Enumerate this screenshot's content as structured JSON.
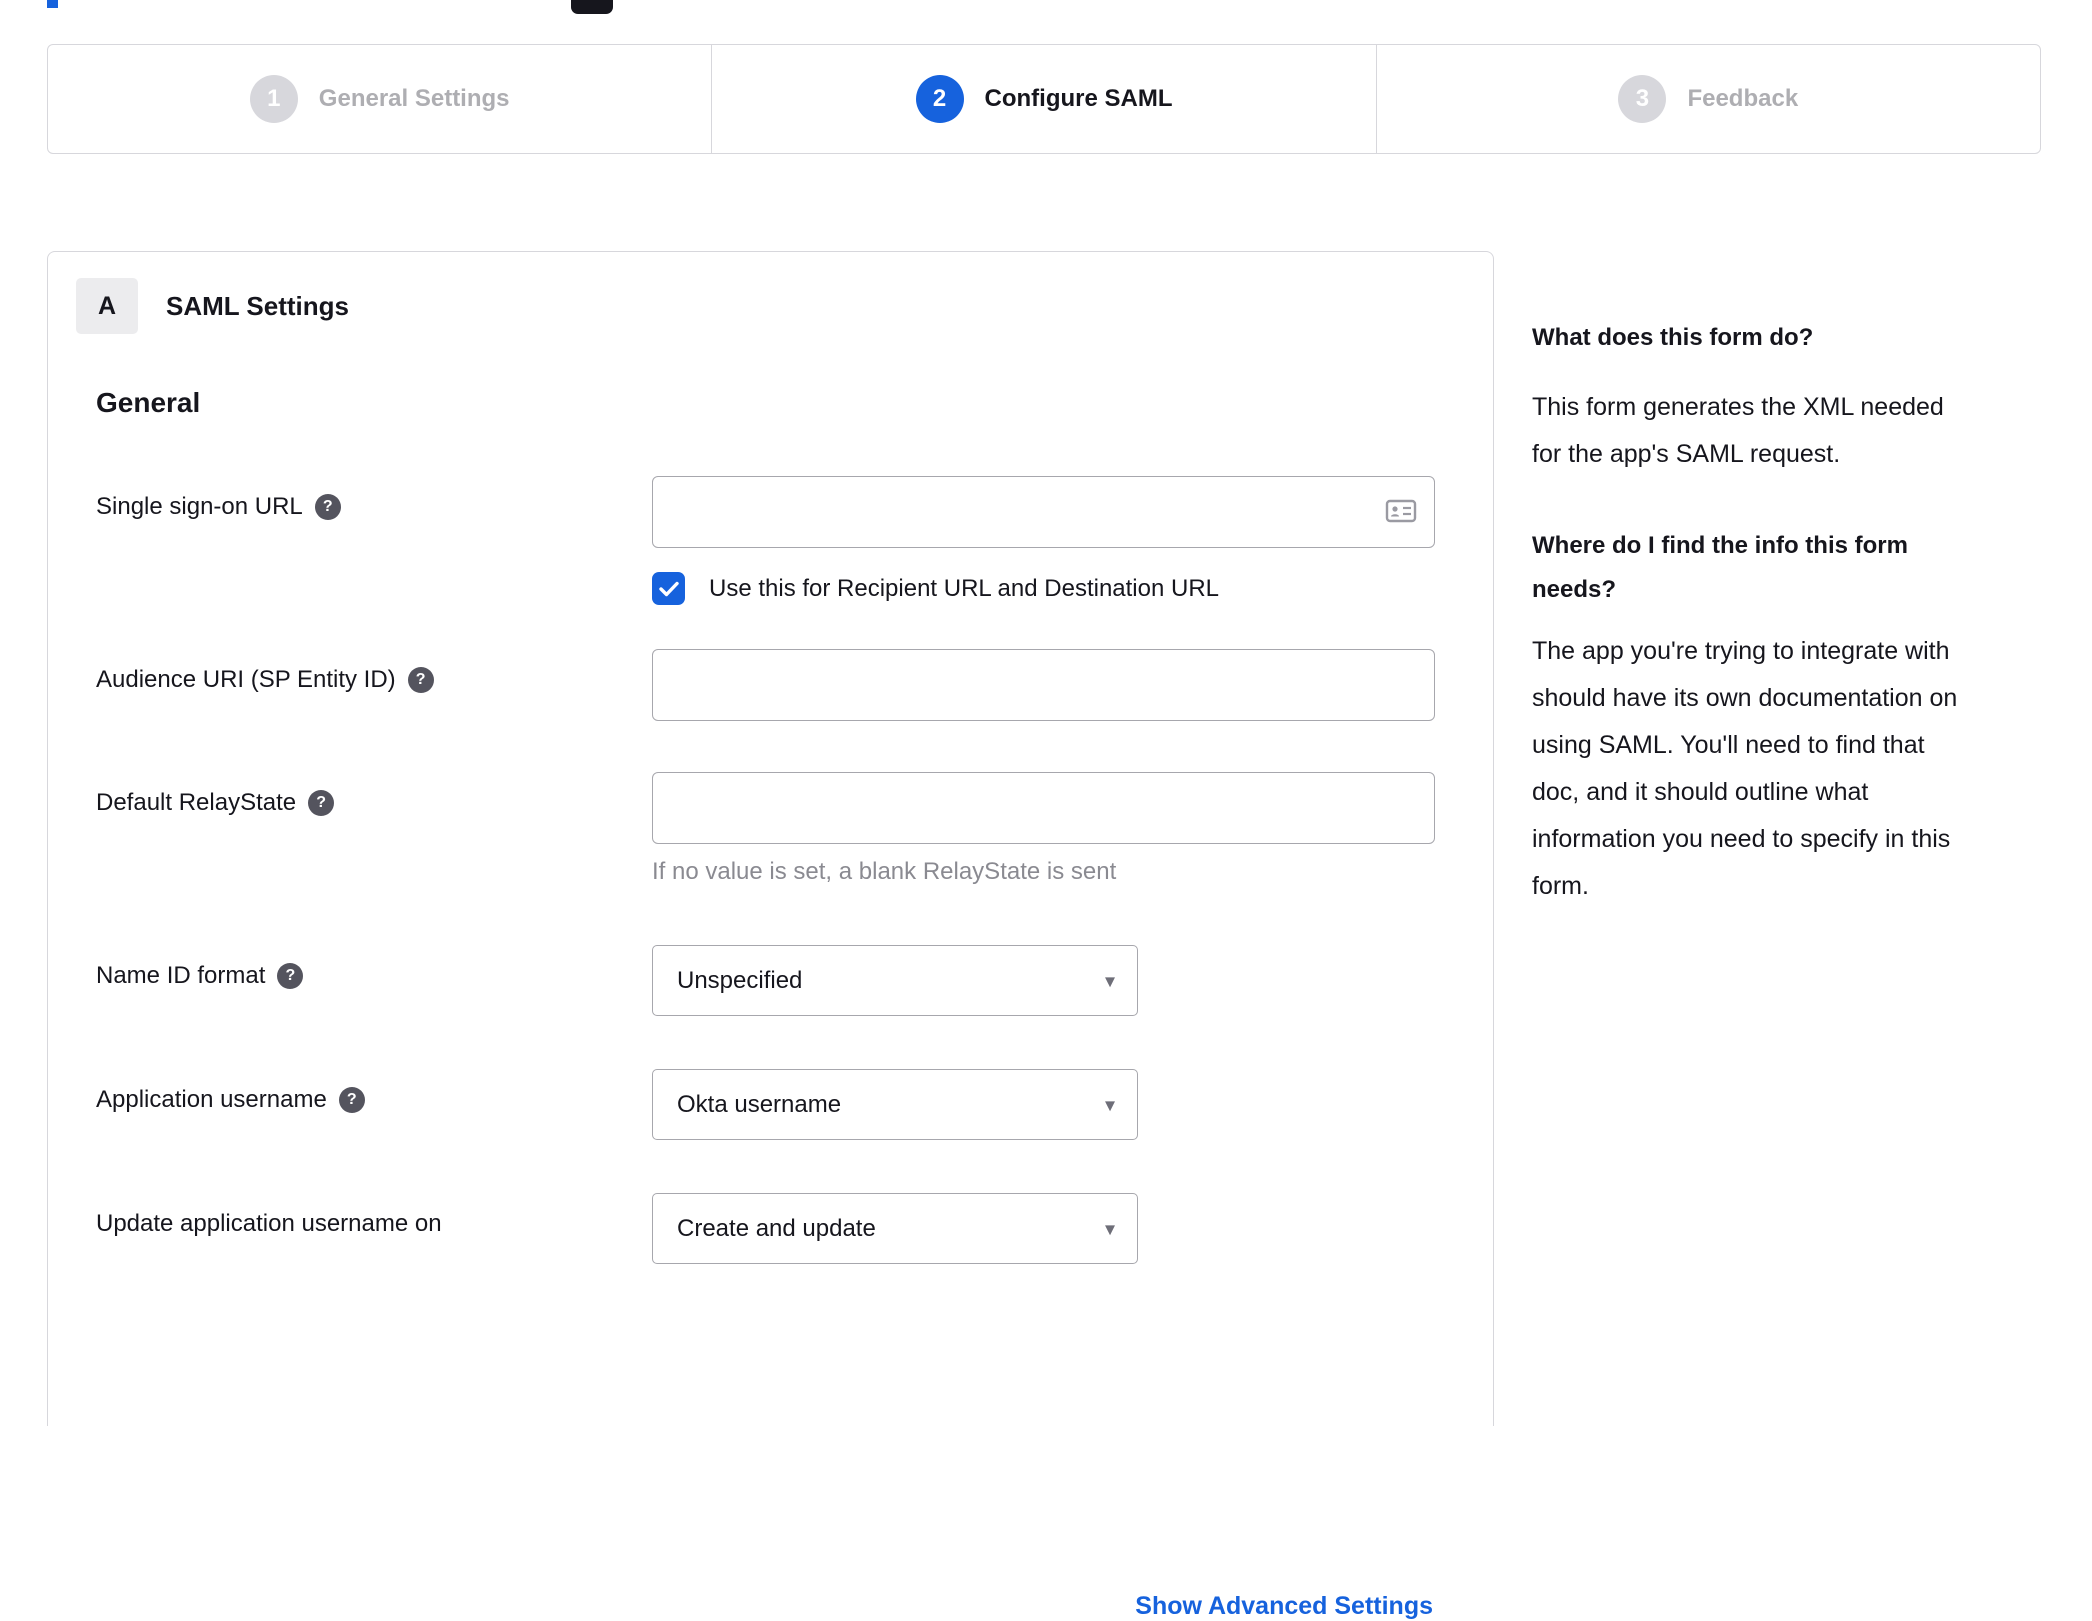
{
  "accent": "#1662dd",
  "icons": {
    "help": "?",
    "caret": "▾"
  },
  "stepper": {
    "steps": [
      {
        "number": "1",
        "label": "General Settings",
        "state": "inactive"
      },
      {
        "number": "2",
        "label": "Configure SAML",
        "state": "active"
      },
      {
        "number": "3",
        "label": "Feedback",
        "state": "inactive"
      }
    ]
  },
  "panel": {
    "badge": "A",
    "title": "SAML Settings",
    "section": "General",
    "fields": {
      "sso": {
        "label": "Single sign-on URL",
        "value": "",
        "checkbox_label": "Use this for Recipient URL and Destination URL",
        "checked": true
      },
      "audience": {
        "label": "Audience URI (SP Entity ID)",
        "value": ""
      },
      "relay": {
        "label": "Default RelayState",
        "value": "",
        "hint": "If no value is set, a blank RelayState is sent"
      },
      "nameid": {
        "label": "Name ID format",
        "value": "Unspecified"
      },
      "appuser": {
        "label": "Application username",
        "value": "Okta username"
      },
      "updateuser": {
        "label": "Update application username on",
        "value": "Create and update"
      }
    },
    "advanced_link": "Show Advanced Settings"
  },
  "sidebar": {
    "q1": "What does this form do?",
    "a1": "This form generates the XML needed\nfor the app's SAML request.",
    "q2": "Where do I find the info this form\nneeds?",
    "a2": "The app you're trying to integrate with\nshould have its own documentation on\nusing SAML. You'll need to find that\ndoc, and it should outline what\ninformation you need to specify in this\nform."
  }
}
